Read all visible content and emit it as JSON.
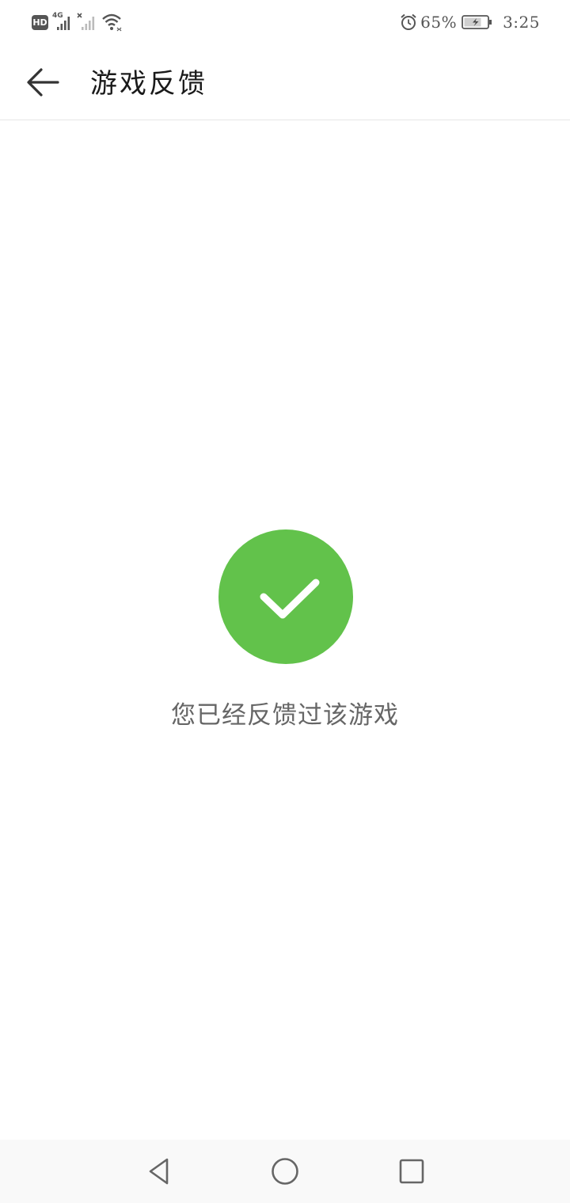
{
  "status_bar": {
    "hd_badge": "HD",
    "network_type": "4G",
    "battery_percent": "65%",
    "time": "3:25",
    "icons": [
      "hd-icon",
      "signal-4g-icon",
      "signal-no-sim-icon",
      "wifi-icon",
      "alarm-icon",
      "battery-charging-icon"
    ]
  },
  "header": {
    "title": "游戏反馈",
    "back_icon": "arrow-left-icon"
  },
  "main": {
    "status_icon": "check-icon",
    "message": "您已经反馈过该游戏",
    "accent_color": "#62c24b"
  },
  "nav_bar": {
    "icons": [
      "back-triangle-icon",
      "home-circle-icon",
      "recents-square-icon"
    ]
  }
}
